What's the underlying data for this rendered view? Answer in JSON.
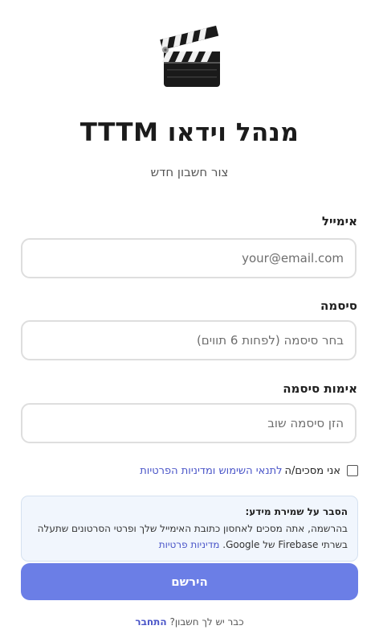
{
  "header": {
    "logo_icon": "clapperboard-icon",
    "title": "מנהל וידאו TTTM",
    "subtitle": "צור חשבון חדש"
  },
  "form": {
    "email": {
      "label": "אימייל",
      "placeholder": "your@email.com",
      "value": ""
    },
    "password": {
      "label": "סיסמה",
      "placeholder": "בחר סיסמה (לפחות 6 תווים)",
      "value": ""
    },
    "confirm": {
      "label": "אימות סיסמה",
      "placeholder": "הזן סיסמה שוב",
      "value": ""
    },
    "agree": {
      "checked": false,
      "text": "אני מסכים/ה",
      "link": "לתנאי השימוש ומדיניות הפרטיות"
    }
  },
  "info": {
    "title": "הסבר על שמירת מידע:",
    "body_line1": "בהרשמה, אתה מסכים לאחסון כתובת האימייל שלך ופרטי הסרטונים שתעלה",
    "body_line2": "בשרתי Firebase של Google.",
    "link": "מדיניות פרטיות"
  },
  "register_label": "הירשם",
  "login": {
    "question": "כבר יש לך חשבון?",
    "link": "התחבר"
  },
  "colors": {
    "accent": "#6b7ee6",
    "link": "#4a55c8",
    "info_bg": "#f1f6fd"
  }
}
